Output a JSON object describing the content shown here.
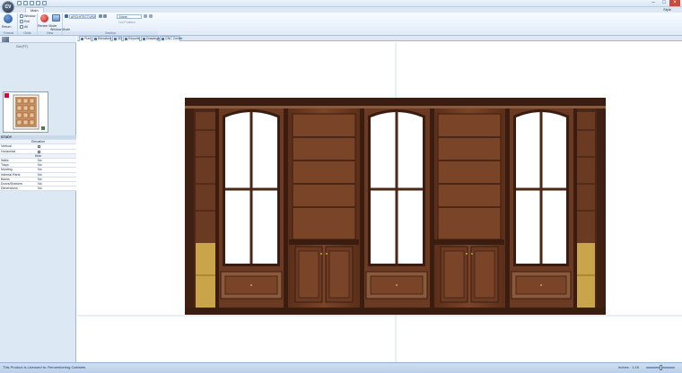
{
  "app": {
    "orb_label": "CV",
    "style_label": "Style"
  },
  "ribbon": {
    "tab": "Main",
    "groups": [
      {
        "name": "Format"
      },
      {
        "name": "Grids"
      },
      {
        "name": "View"
      },
      {
        "name": "Section"
      }
    ],
    "buttons": {
      "return": "Return",
      "window": "Window",
      "roll": "Roll",
      "all": "All",
      "render_mode": "Render Mode",
      "window_mode": "Window Mode",
      "architectural_combo": "ARCHITECTURAL",
      "section_combo": "-None-",
      "cut_position": "Cut Position"
    }
  },
  "left_panel": {
    "cut_label": "Cut (F7)",
    "room_title": "STUDY",
    "properties": [
      {
        "key": "",
        "value": "Elevation",
        "kind": "center"
      },
      {
        "key": "Vertical",
        "value": "",
        "kind": "check"
      },
      {
        "key": "Horizontal",
        "value": "",
        "kind": "check"
      },
      {
        "key": "",
        "value": "Hide",
        "kind": "center"
      },
      {
        "key": "Walls",
        "value": "No",
        "kind": "row"
      },
      {
        "key": "Trays",
        "value": "No",
        "kind": "row"
      },
      {
        "key": "Molding",
        "value": "No",
        "kind": "row"
      },
      {
        "key": "Internal Parts",
        "value": "No",
        "kind": "row"
      },
      {
        "key": "Backs",
        "value": "No",
        "kind": "row"
      },
      {
        "key": "Doors/Drawers",
        "value": "No",
        "kind": "row"
      },
      {
        "key": "Dimensions",
        "value": "No",
        "kind": "row"
      }
    ]
  },
  "doc_tabs": [
    {
      "label": "Plan",
      "active": true
    },
    {
      "label": "Elevation"
    },
    {
      "label": "3D"
    },
    {
      "label": "Reports"
    },
    {
      "label": "Drawings"
    },
    {
      "label": "CNC Center"
    }
  ],
  "status": {
    "text": "This Product is Licensed to: Remembering Cabinets",
    "zoom": "Inches · 1:16"
  },
  "colors": {
    "wood_dark": "#4a2716",
    "wood_mid": "#6b3a22",
    "wood_light": "#8a5a3c",
    "glass": "#ffffff",
    "drawer_gold": "#c9a44a",
    "canvas_guide": "#cfe0ee"
  }
}
